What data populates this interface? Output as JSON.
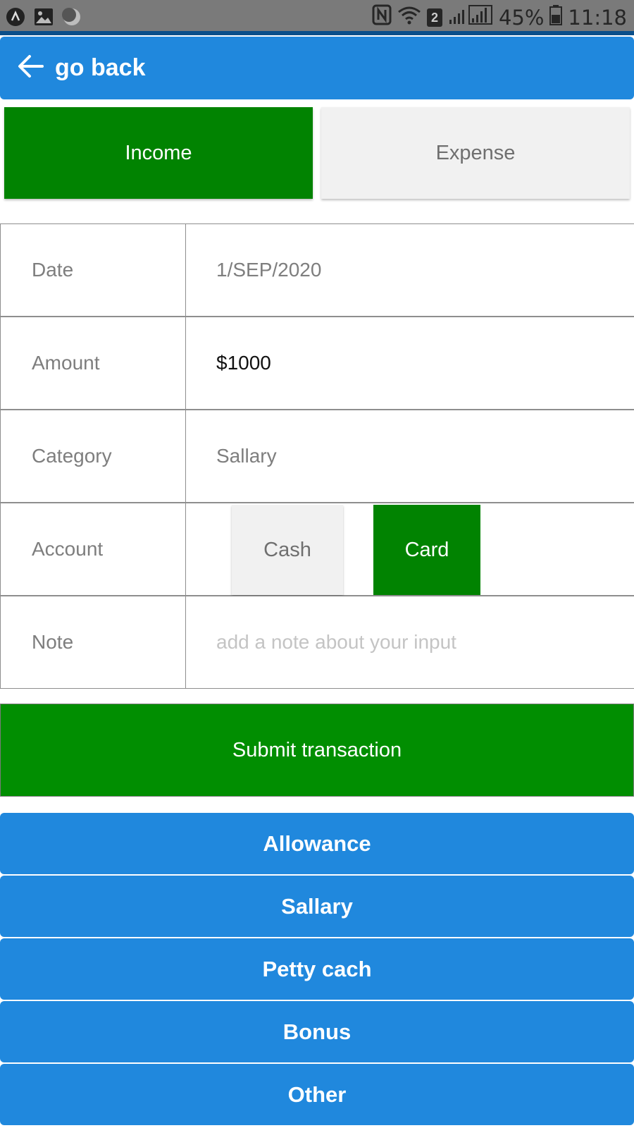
{
  "status_bar": {
    "icons": [
      "app-icon",
      "image-icon",
      "moon-icon",
      "nfc-icon",
      "wifi-icon",
      "signal-icon",
      "battery-icon"
    ],
    "sim_badge": "2",
    "battery": "45%",
    "time": "11:18"
  },
  "appbar": {
    "back_label": "go back",
    "color": "#2088dd"
  },
  "type_toggle": {
    "income_label": "Income",
    "expense_label": "Expense",
    "selected": "Income",
    "active_color": "#018301"
  },
  "form": {
    "date": {
      "label": "Date",
      "value": "1/SEP/2020"
    },
    "amount": {
      "label": "Amount",
      "value": "$1000"
    },
    "category": {
      "label": "Category",
      "value": "Sallary"
    },
    "account": {
      "label": "Account",
      "options": [
        "Cash",
        "Card"
      ],
      "selected": "Card"
    },
    "note": {
      "label": "Note",
      "placeholder": "add a note about your input"
    }
  },
  "submit_label": "Submit transaction",
  "categories": [
    {
      "label": "Allowance"
    },
    {
      "label": "Sallary"
    },
    {
      "label": "Petty cach"
    },
    {
      "label": "Bonus"
    },
    {
      "label": "Other"
    }
  ]
}
